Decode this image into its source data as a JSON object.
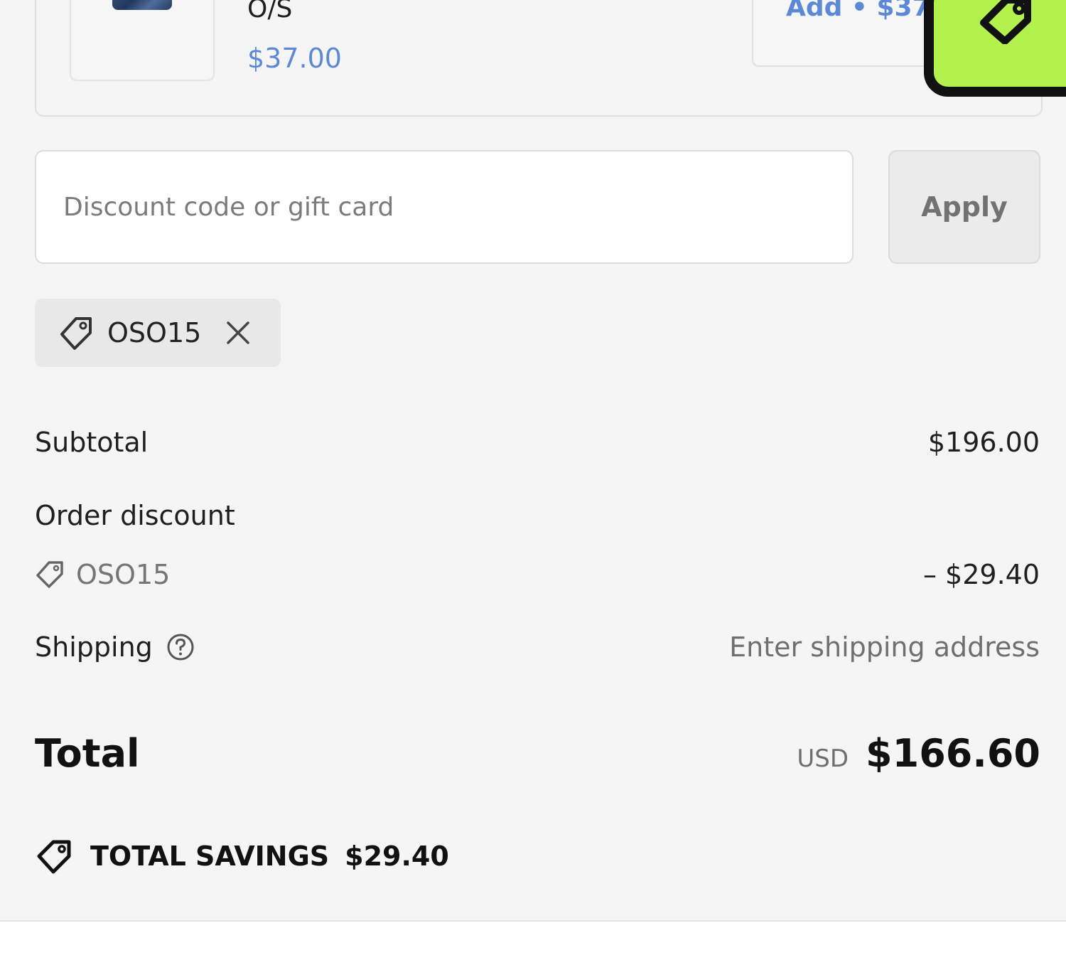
{
  "upsell": {
    "variant": "O/S",
    "price": "$37.00",
    "add_label": "Add • $37",
    "thumbnail_icon": "product-image"
  },
  "widget": {
    "icon": "tag-icon",
    "color": "#b3f24d"
  },
  "discount": {
    "placeholder": "Discount code or gift card",
    "value": "",
    "apply_label": "Apply"
  },
  "applied_code": {
    "code": "OSO15",
    "remove_icon": "close-icon"
  },
  "summary": {
    "subtotal_label": "Subtotal",
    "subtotal_value": "$196.00",
    "order_discount_label": "Order discount",
    "discount_code": "OSO15",
    "discount_value": "– $29.40",
    "shipping_label": "Shipping",
    "shipping_value": "Enter shipping address",
    "total_label": "Total",
    "currency": "USD",
    "total_value": "$166.60"
  },
  "savings": {
    "label": "TOTAL SAVINGS",
    "amount": "$29.40"
  },
  "colors": {
    "accent_link": "#5c89d6",
    "background": "#f5f5f5"
  }
}
